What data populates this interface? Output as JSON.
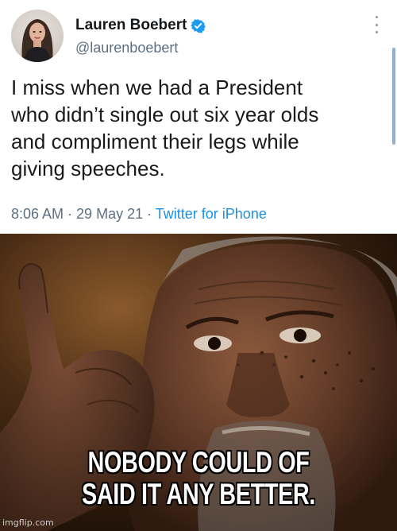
{
  "tweet": {
    "display_name": "Lauren Boebert",
    "handle": "@laurenboebert",
    "text": "I miss when we had a President\nwho didn’t single out six year olds\nand compliment their legs while\ngiving speeches.",
    "time": "8:06 AM",
    "date": "29 May 21",
    "client": "Twitter for iPhone",
    "separator": " · ",
    "verified": true,
    "icons": [
      "avatar",
      "verified-badge-icon",
      "more-options-icon"
    ]
  },
  "meme": {
    "caption_line1": "NOBODY COULD OF",
    "caption_line2": "SAID IT ANY BETTER.",
    "watermark": "imgflip.com"
  },
  "colors": {
    "name": "#14171a",
    "muted": "#5b7083",
    "link": "#1d8fe0",
    "verified": "#1d9bf0",
    "caption": "#ffffff"
  }
}
